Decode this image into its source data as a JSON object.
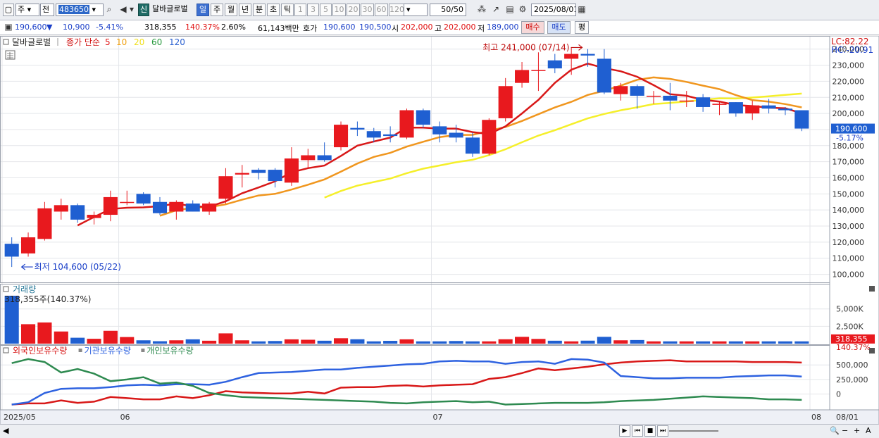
{
  "toolbar": {
    "market": "주",
    "scope": "전",
    "code": "483650",
    "shin": "신",
    "name": "달바글로벌",
    "periods": [
      "일",
      "주",
      "월",
      "년",
      "분",
      "초",
      "틱"
    ],
    "selected_period": "일",
    "minute_buttons": [
      "1",
      "3",
      "5",
      "10",
      "20",
      "30",
      "60",
      "120"
    ],
    "count": "50/50",
    "date": "2025/08/01"
  },
  "quote": {
    "price": "190,600",
    "arrow": "▼",
    "change": "10,900",
    "change_pct": "-5.41%",
    "volume": "318,355",
    "volume_ratio": "140.37%",
    "turnover": "2.60%",
    "amount": "61,143백만",
    "ask_label": "호가",
    "ask": "190,600",
    "bid": "190,500",
    "open_label": "시",
    "open": "202,000",
    "high_label": "고",
    "high": "202,000",
    "low_label": "저",
    "low": "189,000",
    "buy_label": "매수",
    "sell_label": "매도",
    "balance_label": "평"
  },
  "legend": {
    "name": "달바글로벌",
    "ma_label": "종가 단순",
    "ma_periods": [
      "5",
      "10",
      "20",
      "60",
      "120"
    ],
    "ma_colors": [
      "#e01818",
      "#f0a010",
      "#f0e020",
      "#2a9a40",
      "#2a60d0"
    ]
  },
  "colors": {
    "up": "#e8191e",
    "down": "#1f5fd1",
    "ma5": "#d81818",
    "ma10": "#f0961e",
    "ma20": "#f5ef2a",
    "foreign": "#d81818",
    "institution": "#2e62e0",
    "individual": "#2e8a50"
  },
  "chart_data": [
    {
      "type": "candlestick",
      "ylim": [
        95000,
        246000
      ],
      "y_ticks": [
        "100,000",
        "110,000",
        "120,000",
        "130,000",
        "140,000",
        "150,000",
        "160,000",
        "170,000",
        "180,000",
        "190,000",
        "200,000",
        "210,000",
        "220,000",
        "230,000",
        "240,000"
      ],
      "x_labels": [
        {
          "i": 0,
          "label": "2025/05"
        },
        {
          "i": 7,
          "label": "06"
        },
        {
          "i": 26,
          "label": "07"
        },
        {
          "i": 49,
          "label": "08"
        }
      ],
      "right_label": "08/01",
      "info": [
        "LC:82.22",
        "HC:-20.91"
      ],
      "current_price": "190,600",
      "current_change": "-5.17%",
      "high_note": "최고 241,000 (07/14)",
      "high_index": 35,
      "high_value": 241000,
      "low_note": "최저 104,600 (05/22)",
      "low_index": 0,
      "low_value": 104600,
      "candles": [
        {
          "o": 119000,
          "h": 123000,
          "l": 104600,
          "c": 111000
        },
        {
          "o": 113000,
          "h": 126000,
          "l": 111000,
          "c": 123000
        },
        {
          "o": 122000,
          "h": 145000,
          "l": 121000,
          "c": 141000
        },
        {
          "o": 139000,
          "h": 147000,
          "l": 134000,
          "c": 143000
        },
        {
          "o": 143000,
          "h": 144000,
          "l": 132000,
          "c": 134000
        },
        {
          "o": 135000,
          "h": 139000,
          "l": 131000,
          "c": 137000
        },
        {
          "o": 137000,
          "h": 152000,
          "l": 133000,
          "c": 148000
        },
        {
          "o": 145000,
          "h": 152000,
          "l": 143000,
          "c": 145000
        },
        {
          "o": 150000,
          "h": 151000,
          "l": 143000,
          "c": 144000
        },
        {
          "o": 145000,
          "h": 148000,
          "l": 137000,
          "c": 138000
        },
        {
          "o": 139000,
          "h": 146000,
          "l": 134000,
          "c": 145000
        },
        {
          "o": 144000,
          "h": 146000,
          "l": 139000,
          "c": 139000
        },
        {
          "o": 139000,
          "h": 145000,
          "l": 137000,
          "c": 144000
        },
        {
          "o": 147000,
          "h": 166000,
          "l": 144000,
          "c": 161000
        },
        {
          "o": 162000,
          "h": 168000,
          "l": 154000,
          "c": 163000
        },
        {
          "o": 165000,
          "h": 166000,
          "l": 159000,
          "c": 163000
        },
        {
          "o": 165000,
          "h": 166000,
          "l": 154000,
          "c": 158000
        },
        {
          "o": 157000,
          "h": 179000,
          "l": 155000,
          "c": 172000
        },
        {
          "o": 171000,
          "h": 178000,
          "l": 166000,
          "c": 174000
        },
        {
          "o": 174000,
          "h": 182000,
          "l": 170000,
          "c": 171000
        },
        {
          "o": 179000,
          "h": 195000,
          "l": 177000,
          "c": 193000
        },
        {
          "o": 191000,
          "h": 195000,
          "l": 186000,
          "c": 190000
        },
        {
          "o": 189000,
          "h": 191000,
          "l": 182000,
          "c": 185000
        },
        {
          "o": 187000,
          "h": 192000,
          "l": 182000,
          "c": 186000
        },
        {
          "o": 185000,
          "h": 203000,
          "l": 184000,
          "c": 202000
        },
        {
          "o": 202000,
          "h": 203000,
          "l": 191000,
          "c": 193000
        },
        {
          "o": 192000,
          "h": 195000,
          "l": 182000,
          "c": 187000
        },
        {
          "o": 188000,
          "h": 193000,
          "l": 182000,
          "c": 185000
        },
        {
          "o": 185000,
          "h": 188000,
          "l": 173000,
          "c": 175000
        },
        {
          "o": 175000,
          "h": 197000,
          "l": 174000,
          "c": 196000
        },
        {
          "o": 197000,
          "h": 222000,
          "l": 195000,
          "c": 217000
        },
        {
          "o": 219000,
          "h": 232000,
          "l": 216000,
          "c": 227000
        },
        {
          "o": 227000,
          "h": 238000,
          "l": 214000,
          "c": 227000
        },
        {
          "o": 233000,
          "h": 237000,
          "l": 225000,
          "c": 228000
        },
        {
          "o": 234000,
          "h": 241000,
          "l": 224000,
          "c": 237000
        },
        {
          "o": 237000,
          "h": 240000,
          "l": 229000,
          "c": 236000
        },
        {
          "o": 234000,
          "h": 240000,
          "l": 212000,
          "c": 213000
        },
        {
          "o": 212000,
          "h": 219000,
          "l": 208000,
          "c": 217000
        },
        {
          "o": 217000,
          "h": 218000,
          "l": 203000,
          "c": 211000
        },
        {
          "o": 211000,
          "h": 214000,
          "l": 206000,
          "c": 211000
        },
        {
          "o": 211000,
          "h": 219000,
          "l": 202000,
          "c": 208000
        },
        {
          "o": 208000,
          "h": 214000,
          "l": 204000,
          "c": 208000
        },
        {
          "o": 210000,
          "h": 212000,
          "l": 201000,
          "c": 204000
        },
        {
          "o": 206000,
          "h": 207000,
          "l": 199000,
          "c": 206000
        },
        {
          "o": 207000,
          "h": 207000,
          "l": 198000,
          "c": 200000
        },
        {
          "o": 200000,
          "h": 208000,
          "l": 196000,
          "c": 205000
        },
        {
          "o": 205000,
          "h": 209000,
          "l": 200000,
          "c": 203000
        },
        {
          "o": 203000,
          "h": 204000,
          "l": 199000,
          "c": 202000
        },
        {
          "o": 202000,
          "h": 202000,
          "l": 189000,
          "c": 190600
        }
      ]
    },
    {
      "type": "bar",
      "title": "거래량",
      "value_label": "318,355주(140.37%)",
      "ylim": [
        0,
        7200
      ],
      "y_ticks": [
        "2,500K",
        "5,000K"
      ],
      "y_tick_values": [
        2500,
        5000
      ],
      "current_value": "318,355",
      "current_ratio": "140.37%",
      "values": [
        6900,
        2800,
        3050,
        1750,
        850,
        700,
        1850,
        950,
        480,
        350,
        480,
        620,
        420,
        1480,
        480,
        330,
        380,
        620,
        560,
        420,
        780,
        630,
        330,
        400,
        620,
        330,
        330,
        380,
        330,
        330,
        630,
        980,
        680,
        420,
        330,
        430,
        980,
        480,
        520,
        330,
        330,
        330,
        330,
        330,
        330,
        330,
        330,
        330,
        330
      ]
    },
    {
      "type": "line",
      "series_labels": [
        "외국인보유수량",
        "기관보유수량",
        "개인보유수량"
      ],
      "ylim": [
        -270000,
        720000
      ],
      "y_ticks": [
        "500,000",
        "250,000",
        "0"
      ],
      "y_tick_values": [
        500000,
        250000,
        0
      ],
      "series": [
        {
          "name": "외국인보유수량",
          "values": [
            -180000,
            -160000,
            -160000,
            -110000,
            -150000,
            -130000,
            -50000,
            -70000,
            -90000,
            -90000,
            -40000,
            -70000,
            -20000,
            50000,
            30000,
            20000,
            10000,
            10000,
            40000,
            10000,
            110000,
            120000,
            120000,
            140000,
            150000,
            130000,
            150000,
            160000,
            170000,
            260000,
            290000,
            360000,
            440000,
            410000,
            440000,
            470000,
            510000,
            540000,
            560000,
            570000,
            580000,
            560000,
            560000,
            560000,
            560000,
            550000,
            550000,
            550000,
            540000
          ]
        },
        {
          "name": "기관보유수량",
          "values": [
            -180000,
            -140000,
            20000,
            90000,
            100000,
            100000,
            120000,
            150000,
            160000,
            150000,
            170000,
            170000,
            160000,
            210000,
            290000,
            360000,
            370000,
            380000,
            400000,
            420000,
            420000,
            450000,
            470000,
            490000,
            510000,
            520000,
            560000,
            570000,
            560000,
            560000,
            520000,
            550000,
            560000,
            520000,
            600000,
            590000,
            540000,
            310000,
            290000,
            270000,
            270000,
            280000,
            280000,
            280000,
            300000,
            310000,
            320000,
            320000,
            300000
          ]
        },
        {
          "name": "개인보유수량",
          "values": [
            530000,
            600000,
            550000,
            370000,
            430000,
            350000,
            220000,
            250000,
            290000,
            180000,
            200000,
            140000,
            20000,
            -20000,
            -50000,
            -60000,
            -70000,
            -80000,
            -90000,
            -100000,
            -110000,
            -120000,
            -130000,
            -150000,
            -160000,
            -140000,
            -130000,
            -120000,
            -140000,
            -130000,
            -180000,
            -170000,
            -160000,
            -150000,
            -150000,
            -150000,
            -140000,
            -120000,
            -110000,
            -100000,
            -80000,
            -60000,
            -40000,
            -50000,
            -60000,
            -70000,
            -90000,
            -90000,
            -100000
          ]
        }
      ]
    }
  ],
  "status": {
    "buttons": [
      "▶",
      "⏮",
      "■",
      "⏭"
    ],
    "right_icons": [
      "🔍",
      "−",
      "+",
      "A"
    ]
  }
}
